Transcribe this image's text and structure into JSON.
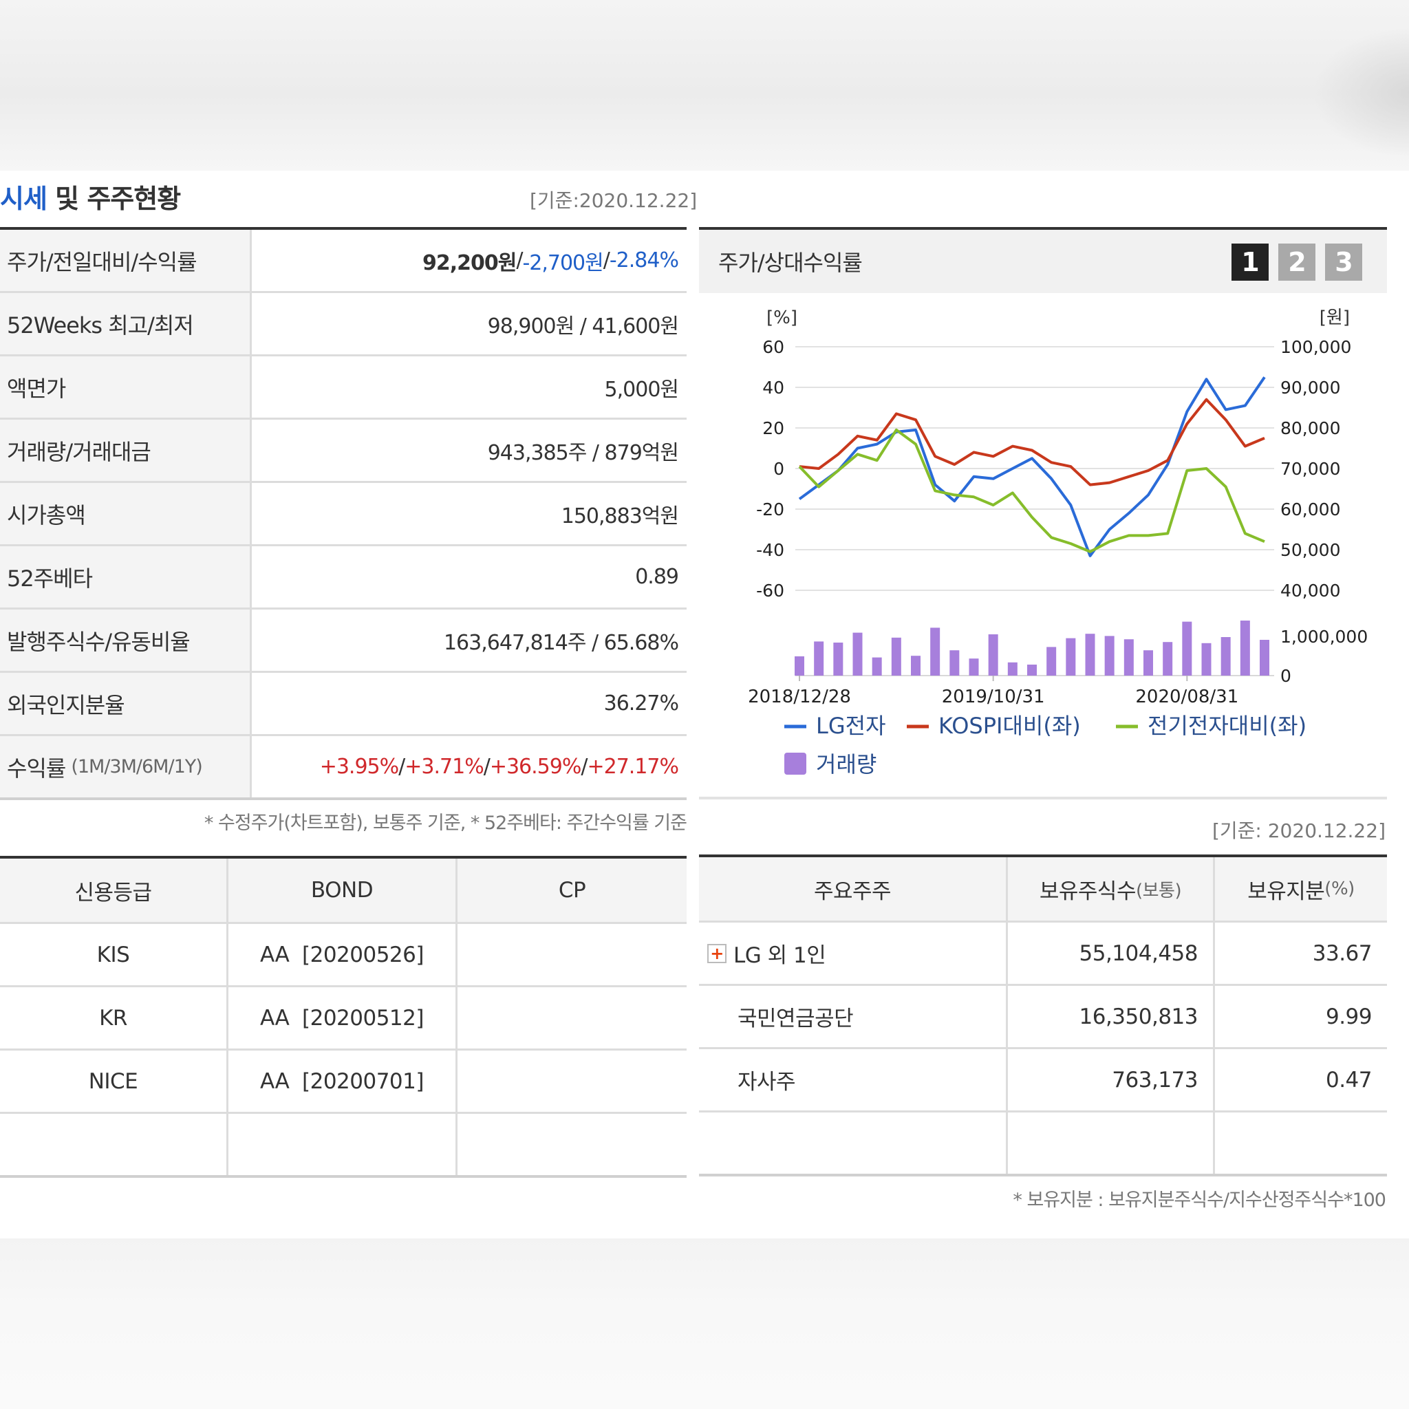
{
  "section": {
    "title_blue": "시세",
    "title_rest": " 및 주주현황",
    "as_of": "[기준:2020.12.22]"
  },
  "info": {
    "price_label": "주가/전일대비/수익률",
    "price": "92,200원",
    "sep1": " / ",
    "change": "-2,700원",
    "sep2": " / ",
    "change_pct": "-2.84%",
    "w52_label": "52Weeks 최고/최저",
    "w52_value": "98,900원 / 41,600원",
    "par_label": "액면가",
    "par_value": "5,000원",
    "volume_label": "거래량/거래대금",
    "volume_value": "943,385주 / 879억원",
    "mcap_label": "시가총액",
    "mcap_value": "150,883억원",
    "beta_label": "52주베타",
    "beta_value": "0.89",
    "shares_label": "발행주식수/유동비율",
    "shares_value": "163,647,814주 / 65.68%",
    "foreign_label": "외국인지분율",
    "foreign_value": "36.27%",
    "return_label": "수익률",
    "return_sub": "(1M/3M/6M/1Y)",
    "return_1m": "+3.95%",
    "return_3m": "+3.71%",
    "return_6m": "+36.59%",
    "return_1y": "+27.17%",
    "return_sep": "/ "
  },
  "note_left": "* 수정주가(차트포함), 보통주 기준, * 52주베타: 주간수익률 기준",
  "chart_panel": {
    "title": "주가/상대수익률",
    "tabs": [
      "1",
      "2",
      "3"
    ],
    "active_tab": "1",
    "as_of": "[기준: 2020.12.22]"
  },
  "chart_data": {
    "type": "line",
    "left_unit": "[%]",
    "right_unit": "[원]",
    "left_ticks": [
      "60",
      "40",
      "20",
      "0",
      "-20",
      "-40",
      "-60"
    ],
    "right_ticks": [
      "100,000",
      "90,000",
      "80,000",
      "70,000",
      "60,000",
      "50,000",
      "40,000"
    ],
    "volume_ticks": [
      "1,000,000",
      "0"
    ],
    "x_labels": [
      "2018/12/28",
      "2019/10/31",
      "2020/08/31"
    ],
    "ylim_left": [
      -60,
      60
    ],
    "ylim_right": [
      40000,
      100000
    ],
    "series": [
      {
        "name": "LG전자",
        "color": "#2a6bd8",
        "values": [
          -15,
          -8,
          -1,
          10,
          12,
          18,
          19,
          -8,
          -16,
          -4,
          -5,
          0,
          5,
          -5,
          -18,
          -43,
          -30,
          -22,
          -13,
          2,
          28,
          44,
          29,
          31,
          45
        ]
      },
      {
        "name": "KOSPI대비(좌)",
        "color": "#c8381c",
        "values": [
          1,
          0,
          7,
          16,
          14,
          27,
          24,
          6,
          2,
          8,
          6,
          11,
          9,
          3,
          1,
          -8,
          -7,
          -4,
          -1,
          4,
          22,
          34,
          24,
          11,
          15
        ]
      },
      {
        "name": "전기전자대비(좌)",
        "color": "#86bd2b",
        "values": [
          1,
          -9,
          -1,
          7,
          4,
          19,
          12,
          -11,
          -13,
          -14,
          -18,
          -12,
          -24,
          -34,
          -37,
          -41,
          -36,
          -33,
          -33,
          -32,
          -1,
          0,
          -9,
          -32,
          -36
        ]
      }
    ],
    "volume_series": {
      "name": "거래량",
      "color": "#a77fdc",
      "values": [
        0.35,
        0.62,
        0.6,
        0.78,
        0.33,
        0.69,
        0.36,
        0.87,
        0.46,
        0.31,
        0.75,
        0.24,
        0.2,
        0.52,
        0.68,
        0.76,
        0.72,
        0.66,
        0.46,
        0.61,
        0.98,
        0.59,
        0.7,
        1.0,
        0.65
      ]
    }
  },
  "credit_table": {
    "headers": [
      "신용등급",
      "BOND",
      "CP"
    ],
    "rows": [
      [
        "KIS",
        "AA  [20200526]",
        ""
      ],
      [
        "KR",
        "AA  [20200512]",
        ""
      ],
      [
        "NICE",
        "AA  [20200701]",
        ""
      ],
      [
        "",
        "",
        ""
      ]
    ]
  },
  "shareholder_table": {
    "h1": "주요주주",
    "h2": "보유주식수",
    "h2_sub": "(보통)",
    "h3": "보유지분",
    "h3_sub": "(%)",
    "rows": [
      [
        "LG 외 1인",
        "55,104,458",
        "33.67"
      ],
      [
        "국민연금공단",
        "16,350,813",
        "9.99"
      ],
      [
        "자사주",
        "763,173",
        "0.47"
      ],
      [
        "",
        "",
        ""
      ]
    ],
    "note": "* 보유지분 : 보유지분주식수/지수산정주식수*100"
  }
}
